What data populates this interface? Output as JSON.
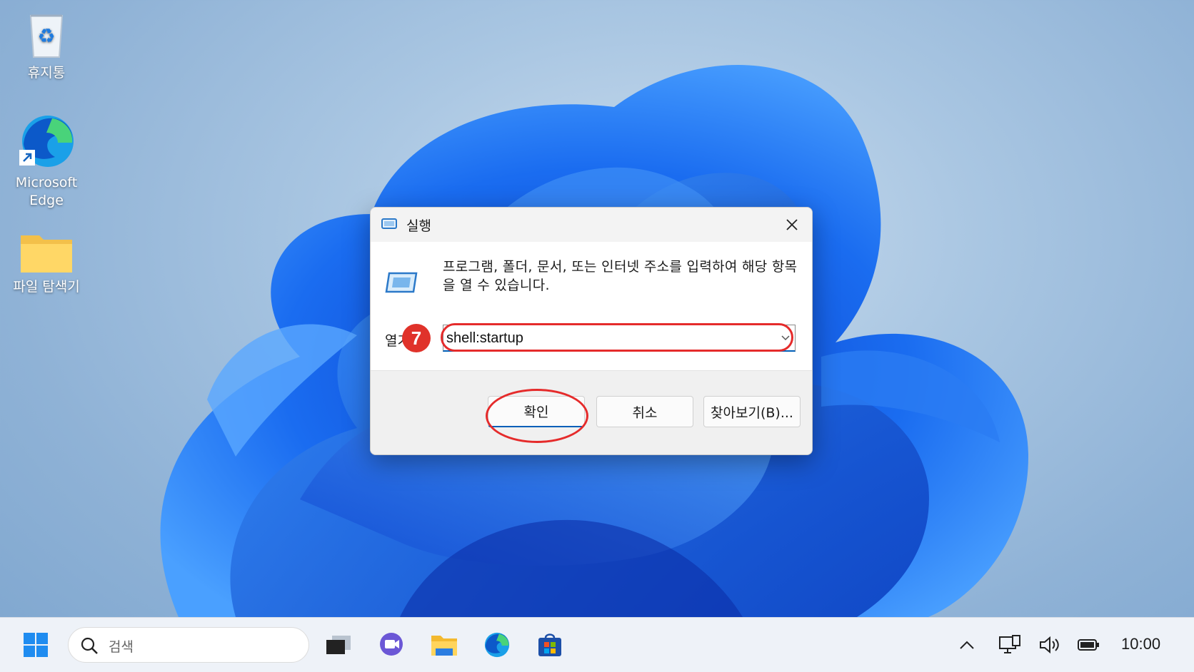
{
  "desktop": {
    "icons": [
      {
        "label": "휴지통"
      },
      {
        "label": "Microsoft Edge"
      },
      {
        "label": "파일 탐색기"
      }
    ]
  },
  "dialog": {
    "title": "실행",
    "description": "프로그램, 폴더, 문서, 또는 인터넷 주소를 입력하여 해당 항목을 열 수 있습니다.",
    "open_label": "열기",
    "input_value": "shell:startup",
    "buttons": {
      "ok": "확인",
      "cancel": "취소",
      "browse": "찾아보기(B)..."
    }
  },
  "annotation": {
    "step_number": "7",
    "color": "#e52b2b"
  },
  "taskbar": {
    "search_placeholder": "검색",
    "clock": "10:00",
    "accent": "#005fb8"
  }
}
